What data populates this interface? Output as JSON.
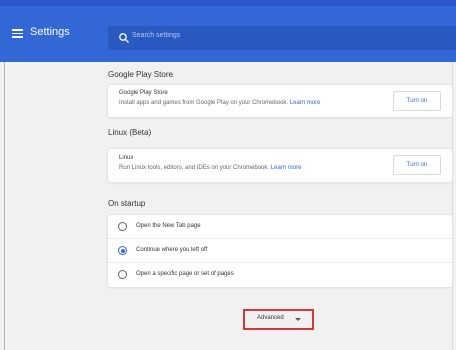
{
  "app": {
    "title": "Settings"
  },
  "search": {
    "placeholder": "Search settings"
  },
  "sections": {
    "play_store": {
      "heading": "Google Play Store",
      "item_title": "Google Play Store",
      "description": "Install apps and games from Google Play on your Chromebook.",
      "link": "Learn more",
      "button": "Turn on"
    },
    "linux": {
      "heading": "Linux (Beta)",
      "item_title": "Linux",
      "description": "Run Linux tools, editors, and IDEs on your Chromebook.",
      "link": "Learn more",
      "button": "Turn on"
    },
    "startup": {
      "heading": "On startup",
      "options": [
        {
          "label": "Open the New Tab page",
          "selected": false
        },
        {
          "label": "Continue where you left off",
          "selected": true
        },
        {
          "label": "Open a specific page or set of pages",
          "selected": false
        }
      ]
    }
  },
  "advanced": {
    "label": "Advanced"
  },
  "colors": {
    "header": "#3367d6",
    "accent": "#3367d6",
    "highlight_box": "#d23a3a"
  }
}
